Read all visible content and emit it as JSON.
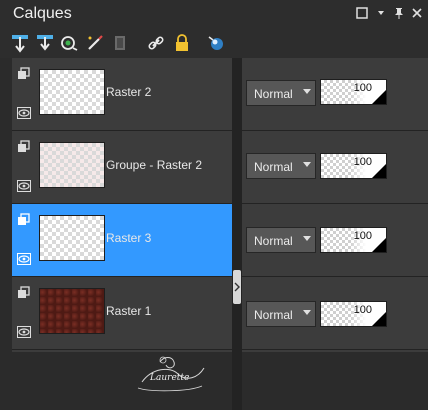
{
  "panel": {
    "title": "Calques"
  },
  "layers": [
    {
      "name": "Raster 2",
      "blend_mode": "Normal",
      "opacity": "100",
      "selected": false,
      "thumb": "transparent"
    },
    {
      "name": "Groupe - Raster 2",
      "blend_mode": "Normal",
      "opacity": "100",
      "selected": false,
      "thumb": "pink"
    },
    {
      "name": "Raster 3",
      "blend_mode": "Normal",
      "opacity": "100",
      "selected": true,
      "thumb": "transparent"
    },
    {
      "name": "Raster 1",
      "blend_mode": "Normal",
      "opacity": "100",
      "selected": false,
      "thumb": "texture"
    }
  ],
  "watermark": {
    "text": "Laurette"
  },
  "colors": {
    "selection": "#3399ff",
    "panel_bg": "#3c3c3c"
  }
}
